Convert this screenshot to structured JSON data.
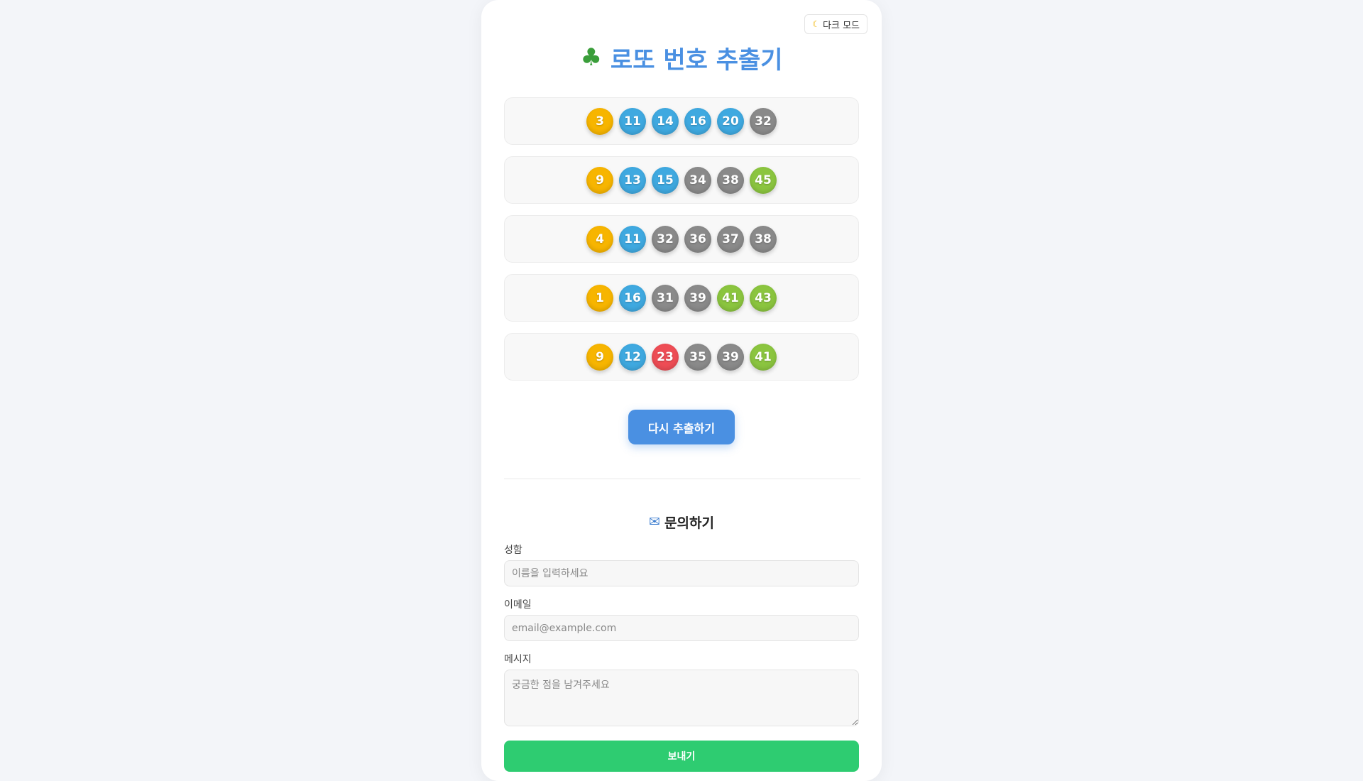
{
  "header": {
    "dark_mode_icon": "moon-icon",
    "dark_mode_label": "다크 모드",
    "title_icon": "four-leaf-clover-icon",
    "title": "로또 번호 추출기"
  },
  "ball_colors": {
    "yellow": "#f7b500",
    "blue": "#3fa9e0",
    "red": "#ee4d55",
    "gray": "#8a8a8a",
    "green": "#8bc53f"
  },
  "lotto_rows": [
    [
      3,
      11,
      14,
      16,
      20,
      32
    ],
    [
      9,
      13,
      15,
      34,
      38,
      45
    ],
    [
      4,
      11,
      32,
      36,
      37,
      38
    ],
    [
      1,
      16,
      31,
      39,
      41,
      43
    ],
    [
      9,
      12,
      23,
      35,
      39,
      41
    ]
  ],
  "regenerate_label": "다시 추출하기",
  "contact": {
    "title_icon": "mailbox-icon",
    "title": "문의하기",
    "name_label": "성함",
    "name_placeholder": "이름을 입력하세요",
    "email_label": "이메일",
    "email_placeholder": "email@example.com",
    "message_label": "메시지",
    "message_placeholder": "궁금한 점을 남겨주세요",
    "send_label": "보내기"
  }
}
